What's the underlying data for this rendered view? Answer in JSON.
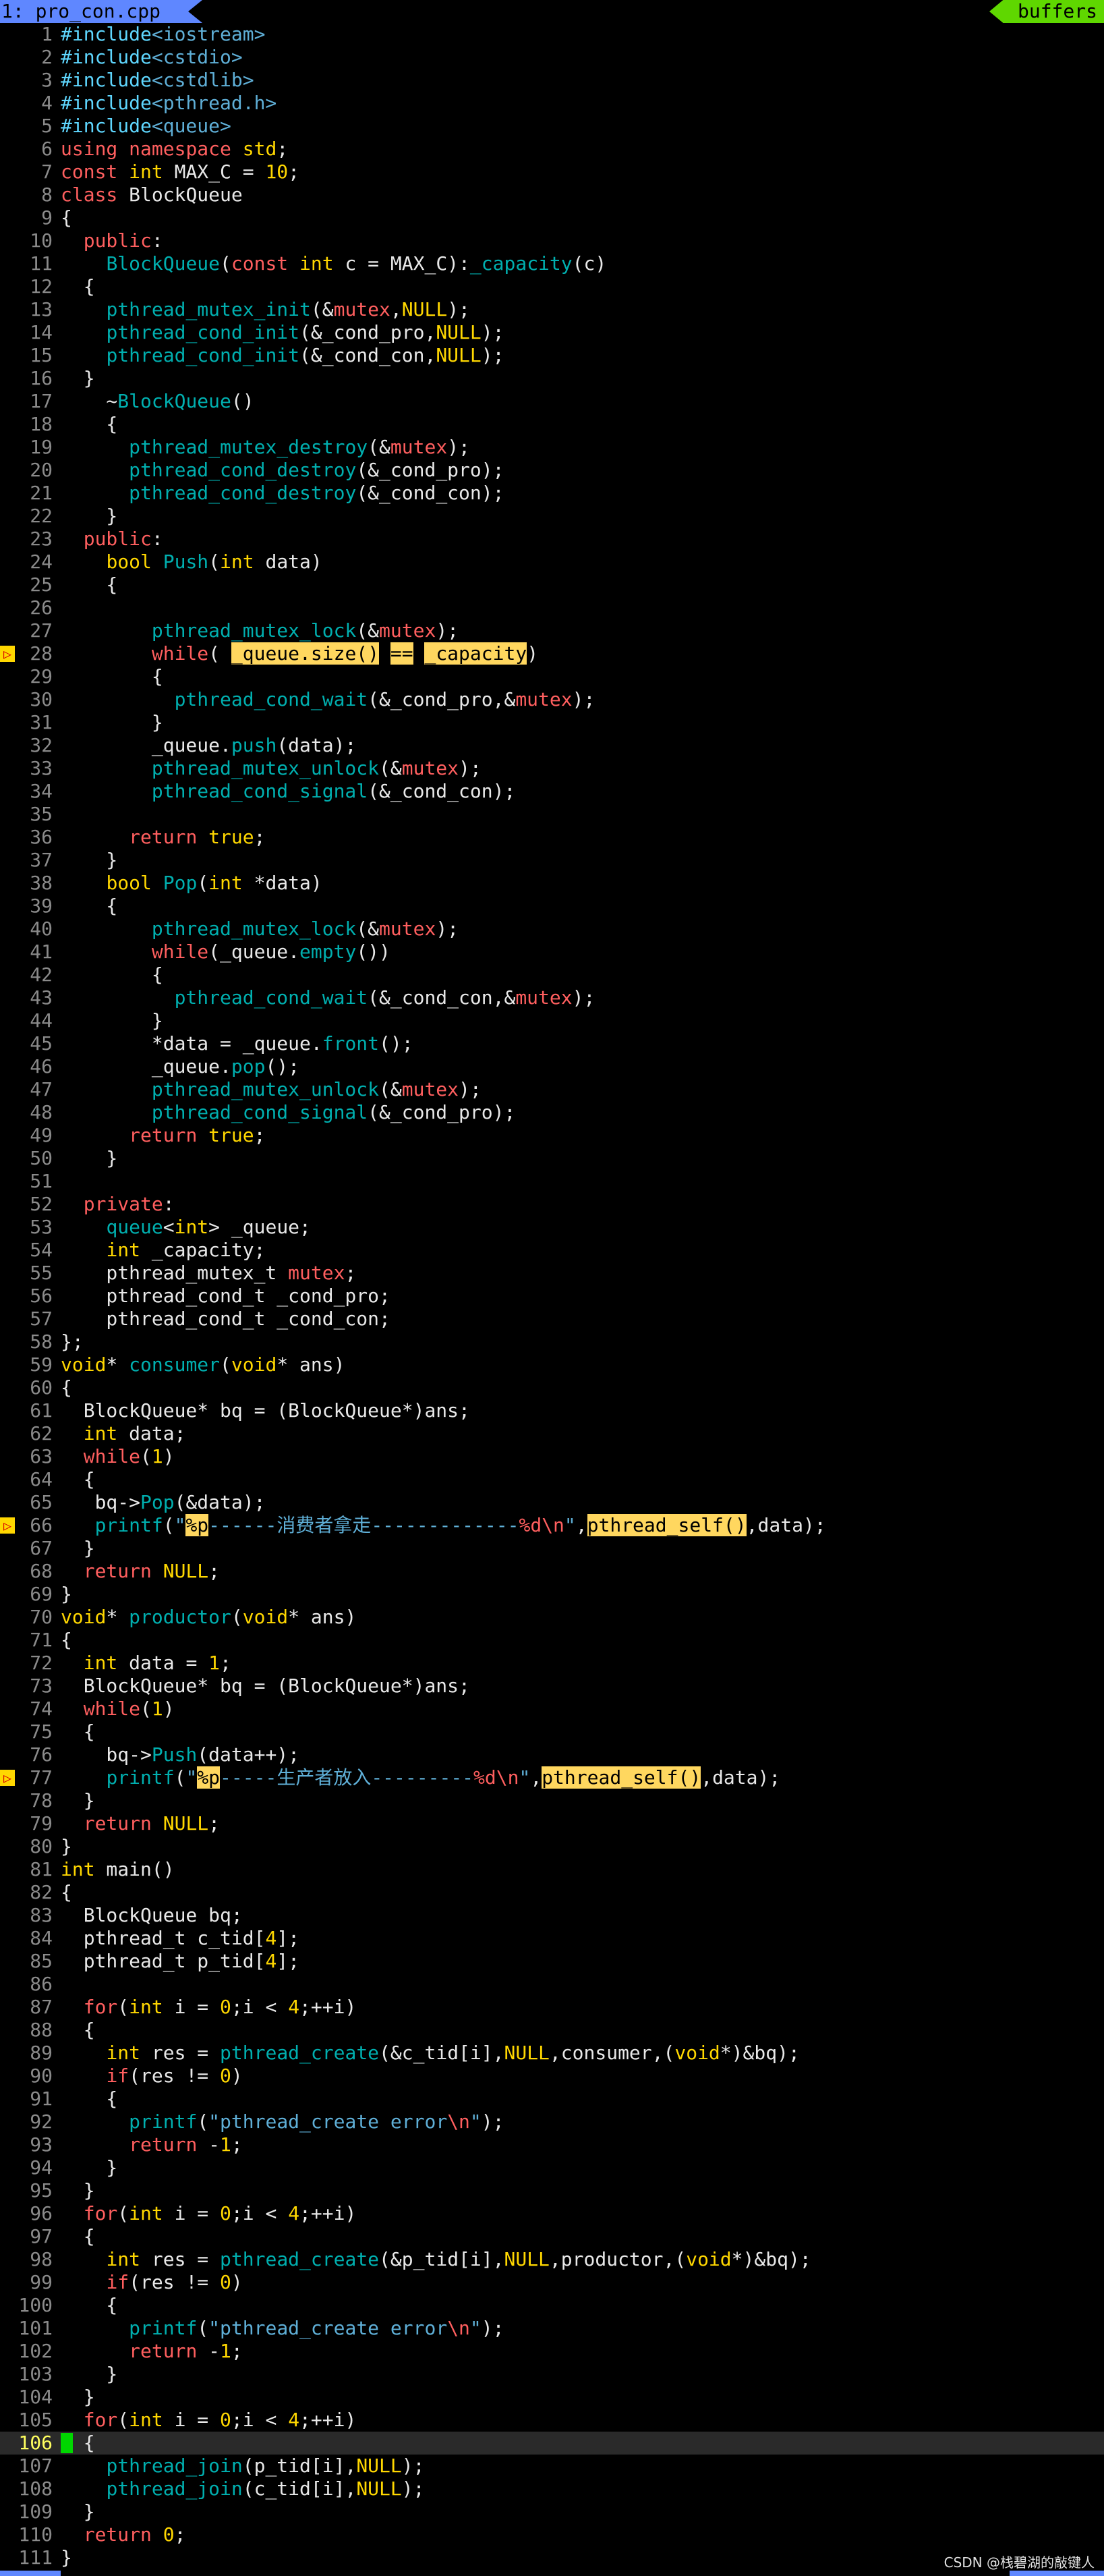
{
  "tabbar": {
    "active_tab": "1: pro_con.cpp",
    "buffers_label": "buffers"
  },
  "watermark": "CSDN @栈碧湖的敲键人",
  "cursor_line": 106,
  "colors": {
    "keyword": "#ff5f5f",
    "type": "#ffd700",
    "function": "#00afaf",
    "string": "#5fafd7",
    "preprocessor": "#5fd7ff",
    "search_highlight": "#ffd75f",
    "tab_active": "#5f87ff",
    "buffers": "#5fd700",
    "sign": "#ffd700"
  },
  "lines": [
    {
      "n": "1",
      "t": "#include<iostream>"
    },
    {
      "n": "2",
      "t": "#include<cstdio>"
    },
    {
      "n": "3",
      "t": "#include<cstdlib>"
    },
    {
      "n": "4",
      "t": "#include<pthread.h>"
    },
    {
      "n": "5",
      "t": "#include<queue>"
    },
    {
      "n": "6",
      "t": "using namespace std;"
    },
    {
      "n": "7",
      "t": "const int MAX_C = 10;"
    },
    {
      "n": "8",
      "t": "class BlockQueue"
    },
    {
      "n": "9",
      "t": "{"
    },
    {
      "n": "10",
      "t": "  public:"
    },
    {
      "n": "11",
      "t": "    BlockQueue(const int c = MAX_C):_capacity(c)"
    },
    {
      "n": "12",
      "t": "  {"
    },
    {
      "n": "13",
      "t": "    pthread_mutex_init(&mutex,NULL);"
    },
    {
      "n": "14",
      "t": "    pthread_cond_init(&_cond_pro,NULL);"
    },
    {
      "n": "15",
      "t": "    pthread_cond_init(&_cond_con,NULL);"
    },
    {
      "n": "16",
      "t": "  }"
    },
    {
      "n": "17",
      "t": "    ~BlockQueue()"
    },
    {
      "n": "18",
      "t": "    {"
    },
    {
      "n": "19",
      "t": "      pthread_mutex_destroy(&mutex);"
    },
    {
      "n": "20",
      "t": "      pthread_cond_destroy(&_cond_pro);"
    },
    {
      "n": "21",
      "t": "      pthread_cond_destroy(&_cond_con);"
    },
    {
      "n": "22",
      "t": "    }"
    },
    {
      "n": "23",
      "t": "  public:"
    },
    {
      "n": "24",
      "t": "    bool Push(int data)"
    },
    {
      "n": "25",
      "t": "    {"
    },
    {
      "n": "26",
      "t": ""
    },
    {
      "n": "27",
      "t": "        pthread_mutex_lock(&mutex);"
    },
    {
      "n": "28",
      "t": "        while( _queue.size() == _capacity)",
      "sign": true
    },
    {
      "n": "29",
      "t": "        {"
    },
    {
      "n": "30",
      "t": "          pthread_cond_wait(&_cond_pro,&mutex);"
    },
    {
      "n": "31",
      "t": "        }"
    },
    {
      "n": "32",
      "t": "        _queue.push(data);"
    },
    {
      "n": "33",
      "t": "        pthread_mutex_unlock(&mutex);"
    },
    {
      "n": "34",
      "t": "        pthread_cond_signal(&_cond_con);"
    },
    {
      "n": "35",
      "t": ""
    },
    {
      "n": "36",
      "t": "      return true;"
    },
    {
      "n": "37",
      "t": "    }"
    },
    {
      "n": "38",
      "t": "    bool Pop(int *data)"
    },
    {
      "n": "39",
      "t": "    {"
    },
    {
      "n": "40",
      "t": "        pthread_mutex_lock(&mutex);"
    },
    {
      "n": "41",
      "t": "        while(_queue.empty())"
    },
    {
      "n": "42",
      "t": "        {"
    },
    {
      "n": "43",
      "t": "          pthread_cond_wait(&_cond_con,&mutex);"
    },
    {
      "n": "44",
      "t": "        }"
    },
    {
      "n": "45",
      "t": "        *data = _queue.front();"
    },
    {
      "n": "46",
      "t": "        _queue.pop();"
    },
    {
      "n": "47",
      "t": "        pthread_mutex_unlock(&mutex);"
    },
    {
      "n": "48",
      "t": "        pthread_cond_signal(&_cond_pro);"
    },
    {
      "n": "49",
      "t": "      return true;"
    },
    {
      "n": "50",
      "t": "    }"
    },
    {
      "n": "51",
      "t": ""
    },
    {
      "n": "52",
      "t": "  private:"
    },
    {
      "n": "53",
      "t": "    queue<int> _queue;"
    },
    {
      "n": "54",
      "t": "    int _capacity;"
    },
    {
      "n": "55",
      "t": "    pthread_mutex_t mutex;"
    },
    {
      "n": "56",
      "t": "    pthread_cond_t _cond_pro;"
    },
    {
      "n": "57",
      "t": "    pthread_cond_t _cond_con;"
    },
    {
      "n": "58",
      "t": "};"
    },
    {
      "n": "59",
      "t": "void* consumer(void* ans)"
    },
    {
      "n": "60",
      "t": "{"
    },
    {
      "n": "61",
      "t": "  BlockQueue* bq = (BlockQueue*)ans;"
    },
    {
      "n": "62",
      "t": "  int data;"
    },
    {
      "n": "63",
      "t": "  while(1)"
    },
    {
      "n": "64",
      "t": "  {"
    },
    {
      "n": "65",
      "t": "   bq->Pop(&data);"
    },
    {
      "n": "66",
      "t": "   printf(\"%p------消费者拿走-------------%d\\n\",pthread_self(),data);",
      "sign": true
    },
    {
      "n": "67",
      "t": "  }"
    },
    {
      "n": "68",
      "t": "  return NULL;"
    },
    {
      "n": "69",
      "t": "}"
    },
    {
      "n": "70",
      "t": "void* productor(void* ans)"
    },
    {
      "n": "71",
      "t": "{"
    },
    {
      "n": "72",
      "t": "  int data = 1;"
    },
    {
      "n": "73",
      "t": "  BlockQueue* bq = (BlockQueue*)ans;"
    },
    {
      "n": "74",
      "t": "  while(1)"
    },
    {
      "n": "75",
      "t": "  {"
    },
    {
      "n": "76",
      "t": "    bq->Push(data++);"
    },
    {
      "n": "77",
      "t": "    printf(\"%p-----生产者放入---------%d\\n\",pthread_self(),data);",
      "sign": true
    },
    {
      "n": "78",
      "t": "  }"
    },
    {
      "n": "79",
      "t": "  return NULL;"
    },
    {
      "n": "80",
      "t": "}"
    },
    {
      "n": "81",
      "t": "int main()"
    },
    {
      "n": "82",
      "t": "{"
    },
    {
      "n": "83",
      "t": "  BlockQueue bq;"
    },
    {
      "n": "84",
      "t": "  pthread_t c_tid[4];"
    },
    {
      "n": "85",
      "t": "  pthread_t p_tid[4];"
    },
    {
      "n": "86",
      "t": ""
    },
    {
      "n": "87",
      "t": "  for(int i = 0;i < 4;++i)"
    },
    {
      "n": "88",
      "t": "  {"
    },
    {
      "n": "89",
      "t": "    int res = pthread_create(&c_tid[i],NULL,consumer,(void*)&bq);"
    },
    {
      "n": "90",
      "t": "    if(res != 0)"
    },
    {
      "n": "91",
      "t": "    {"
    },
    {
      "n": "92",
      "t": "      printf(\"pthread_create error\\n\");"
    },
    {
      "n": "93",
      "t": "      return -1;"
    },
    {
      "n": "94",
      "t": "    }"
    },
    {
      "n": "95",
      "t": "  }"
    },
    {
      "n": "96",
      "t": "  for(int i = 0;i < 4;++i)"
    },
    {
      "n": "97",
      "t": "  {"
    },
    {
      "n": "98",
      "t": "    int res = pthread_create(&p_tid[i],NULL,productor,(void*)&bq);"
    },
    {
      "n": "99",
      "t": "    if(res != 0)"
    },
    {
      "n": "100",
      "t": "    {"
    },
    {
      "n": "101",
      "t": "      printf(\"pthread_create error\\n\");"
    },
    {
      "n": "102",
      "t": "      return -1;"
    },
    {
      "n": "103",
      "t": "    }"
    },
    {
      "n": "104",
      "t": "  }"
    },
    {
      "n": "105",
      "t": "  for(int i = 0;i < 4;++i)"
    },
    {
      "n": "106",
      "t": "  {"
    },
    {
      "n": "107",
      "t": "    pthread_join(p_tid[i],NULL);"
    },
    {
      "n": "108",
      "t": "    pthread_join(c_tid[i],NULL);"
    },
    {
      "n": "109",
      "t": "  }"
    },
    {
      "n": "110",
      "t": "  return 0;"
    },
    {
      "n": "111",
      "t": "}"
    }
  ]
}
